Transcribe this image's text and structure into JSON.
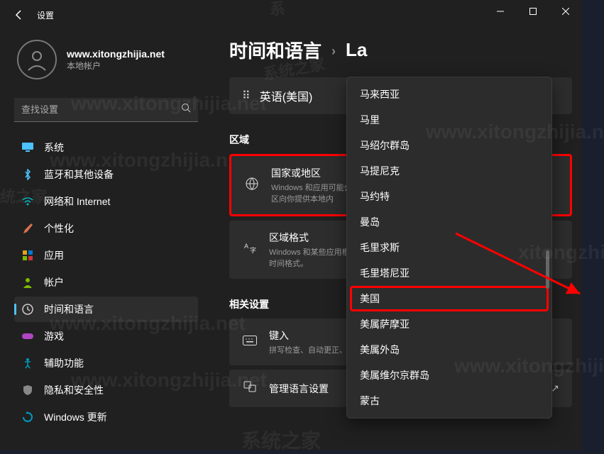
{
  "window": {
    "title": "设置"
  },
  "user": {
    "name": "www.xitongzhijia.net",
    "sub": "本地帐户"
  },
  "search": {
    "placeholder": "查找设置"
  },
  "nav": [
    {
      "key": "system",
      "label": "系统",
      "icon": "monitor",
      "color": "#4cc2ff"
    },
    {
      "key": "bluetooth",
      "label": "蓝牙和其他设备",
      "icon": "bt",
      "color": "#0078d4"
    },
    {
      "key": "network",
      "label": "网络和 Internet",
      "icon": "wifi",
      "color": "#00b7c3"
    },
    {
      "key": "personalize",
      "label": "个性化",
      "icon": "brush",
      "color": "#d13438"
    },
    {
      "key": "apps",
      "label": "应用",
      "icon": "apps",
      "color": "#e3a21a"
    },
    {
      "key": "accounts",
      "label": "帐户",
      "icon": "person",
      "color": "#7fba00"
    },
    {
      "key": "timelang",
      "label": "时间和语言",
      "icon": "clock",
      "color": "#ccc",
      "active": true
    },
    {
      "key": "gaming",
      "label": "游戏",
      "icon": "game",
      "color": "#b146c2"
    },
    {
      "key": "accessibility",
      "label": "辅助功能",
      "icon": "access",
      "color": "#0099bc"
    },
    {
      "key": "privacy",
      "label": "隐私和安全性",
      "icon": "shield",
      "color": "#888"
    },
    {
      "key": "update",
      "label": "Windows 更新",
      "icon": "update",
      "color": "#0099bc"
    }
  ],
  "breadcrumb": {
    "root": "时间和语言",
    "sub": "La"
  },
  "lang_pill": "英语(美国)",
  "sections": {
    "region": "区域",
    "related": "相关设置"
  },
  "cards": {
    "region": {
      "title": "国家或地区",
      "sub": "Windows 和应用可能会根据国家或地区向你提供本地内"
    },
    "format": {
      "title": "区域格式",
      "sub": "Windows 和某些应用根据区置日期和时间格式。"
    },
    "typing": {
      "title": "键入",
      "sub": "拼写检查、自动更正、文本"
    },
    "admin": {
      "title": "管理语言设置"
    }
  },
  "dropdown": [
    "马来西亚",
    "马里",
    "马绍尔群岛",
    "马提尼克",
    "马约特",
    "曼岛",
    "毛里求斯",
    "毛里塔尼亚",
    "美国",
    "美属萨摩亚",
    "美属外岛",
    "美属维尔京群岛",
    "蒙古"
  ],
  "dropdown_highlight_index": 8
}
